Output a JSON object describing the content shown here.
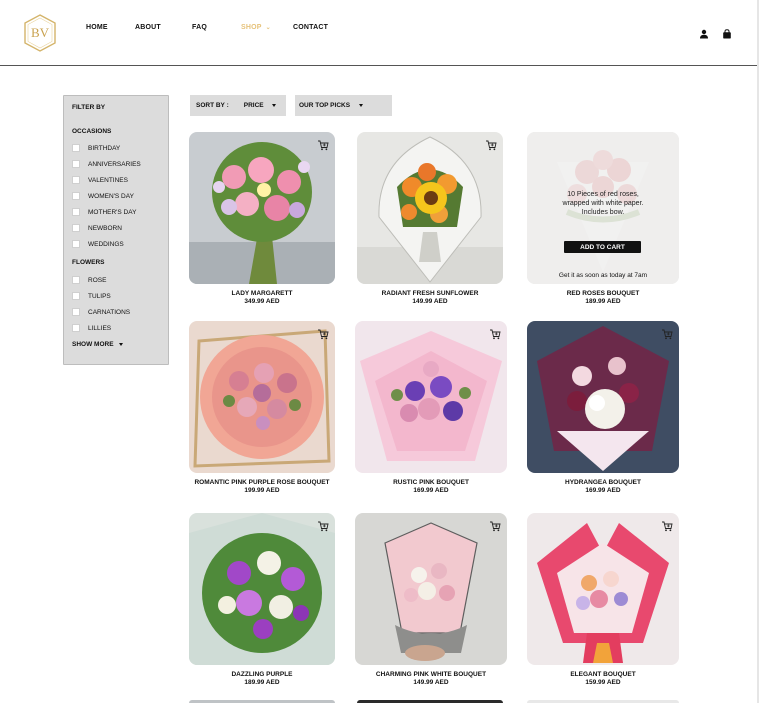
{
  "brand": {
    "logo_text": "BV"
  },
  "nav": {
    "home": "HOME",
    "about": "ABOUT",
    "faq": "FAQ",
    "shop": "SHOP",
    "contact": "CONTACT"
  },
  "colors": {
    "accent_gold": "#e6c27a",
    "panel_gray": "#dcdcdc",
    "button_black": "#111111"
  },
  "filter": {
    "title": "FILTER BY",
    "occasions_title": "OCCASIONS",
    "occasions": [
      "BIRTHDAY",
      "ANNIVERSARIES",
      "VALENTINES",
      "WOMEN'S DAY",
      "MOTHER'S DAY",
      "NEWBORN",
      "WEDDINGS"
    ],
    "flowers_title": "FLOWERS",
    "flowers": [
      "ROSE",
      "TULIPS",
      "CARNATIONS",
      "LILLIES"
    ],
    "show_more": "SHOW MORE"
  },
  "sort": {
    "label": "SORT BY :",
    "price": "PRICE",
    "picks": "OUR TOP PICKS"
  },
  "products": [
    {
      "name": "LADY MARGARETT",
      "price": "349.99 AED"
    },
    {
      "name": "RADIANT FRESH SUNFLOWER",
      "price": "149.99 AED"
    },
    {
      "name": "RED ROSES BOUQUET",
      "price": "189.99 AED"
    },
    {
      "name": "ROMANTIC PINK PURPLE ROSE BOUQUET",
      "price": "199.99 AED"
    },
    {
      "name": "RUSTIC PINK BOUQUET",
      "price": "169.99 AED"
    },
    {
      "name": "HYDRANGEA BOUQUET",
      "price": "169.99 AED"
    },
    {
      "name": "DAZZLING PURPLE",
      "price": "189.99 AED"
    },
    {
      "name": "CHARMING PINK WHITE BOUQUET",
      "price": "149.99 AED"
    },
    {
      "name": "ELEGANT BOUQUET",
      "price": "159.99 AED"
    }
  ],
  "hover_card": {
    "description": "10 Pieces of red roses, wrapped with white paper. Includes bow.",
    "add_to_cart": "ADD TO CART",
    "delivery_note": "Get it as soon as today at 7am"
  }
}
